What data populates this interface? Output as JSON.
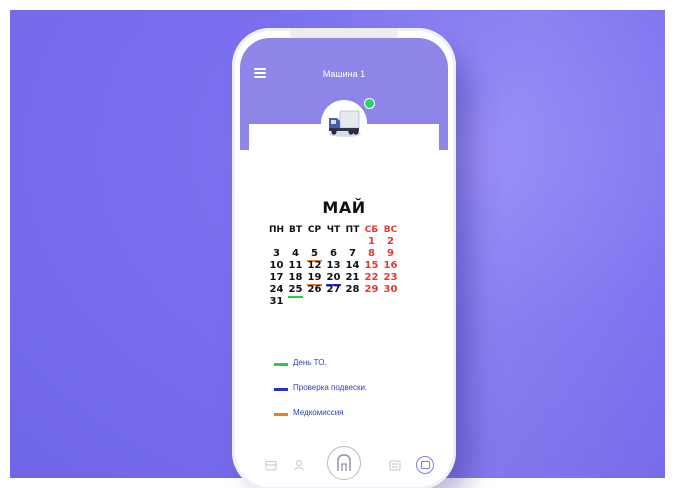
{
  "header": {
    "title": "Машина 1"
  },
  "calendar": {
    "month": "МАЙ",
    "weekdays": [
      "ПН",
      "ВТ",
      "СР",
      "ЧТ",
      "ПТ",
      "СБ",
      "ВС"
    ],
    "weeks": [
      [
        "",
        "",
        "",
        "",
        "",
        "1",
        "2"
      ],
      [
        "3",
        "4",
        "5",
        "6",
        "7",
        "8",
        "9"
      ],
      [
        "10",
        "11",
        "12",
        "13",
        "14",
        "15",
        "16"
      ],
      [
        "17",
        "18",
        "19",
        "20",
        "21",
        "22",
        "23"
      ],
      [
        "24",
        "25",
        "26",
        "27",
        "28",
        "29",
        "30"
      ],
      [
        "31",
        "",
        "",
        "",
        "",
        "",
        ""
      ]
    ],
    "weekend_color": "#e53935",
    "marks": {
      "5": "#f07a2a",
      "19": "#f07a2a",
      "20": "#2b2fc7",
      "25": "#2fc94a"
    }
  },
  "legend": [
    {
      "label": "День ТО.",
      "color": "#2fc94a"
    },
    {
      "label": "Проверка подвески.",
      "color": "#2b2fc7"
    },
    {
      "label": "Медкомиссия",
      "color": "#f07a2a"
    }
  ],
  "icons": {
    "menu": "hamburger-menu-icon",
    "avatar": "truck-icon",
    "nav": [
      "calendar-icon",
      "user-icon",
      "home-icon",
      "list-icon",
      "chat-icon"
    ]
  },
  "colors": {
    "background": "#7b70ef",
    "header": "#8d86e8",
    "status_online": "#2fd06a"
  }
}
